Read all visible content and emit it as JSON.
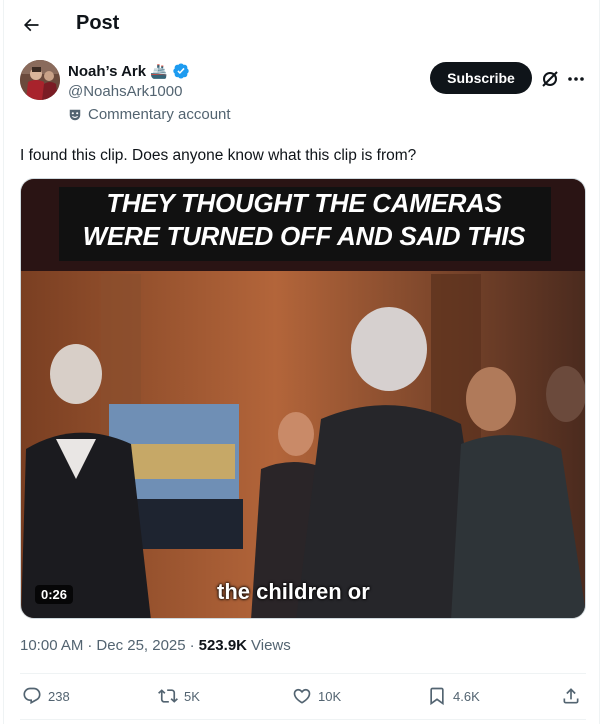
{
  "header": {
    "title": "Post",
    "back_icon": "arrow-left-icon"
  },
  "author": {
    "display_name": "Noah’s Ark",
    "emoji": "🚢",
    "handle": "@NoahsArk1000",
    "badge_label": "Commentary account",
    "verified_color": "#1d9bf0"
  },
  "actions_top": {
    "subscribe_label": "Subscribe",
    "grok_icon": "grok-icon",
    "more_icon": "more-icon"
  },
  "post": {
    "text": "I found this clip. Does anyone know what this clip is from?",
    "video": {
      "caption_line1": "THEY THOUGHT THE CAMERAS",
      "caption_line2": "WERE TURNED OFF AND SAID THIS",
      "subtitle": "the children or",
      "duration": "0:26"
    },
    "meta": {
      "time": "10:00 AM",
      "sep1": "·",
      "date": "Dec 25, 2025",
      "sep2": "·",
      "views_count": "523.9K",
      "views_label": "Views"
    },
    "stats": {
      "replies": "238",
      "reposts": "5K",
      "likes": "10K",
      "bookmarks": "4.6K"
    }
  },
  "colors": {
    "text": "#0f1419",
    "secondary": "#536471",
    "accent": "#1d9bf0",
    "divider": "#eff3f4"
  }
}
